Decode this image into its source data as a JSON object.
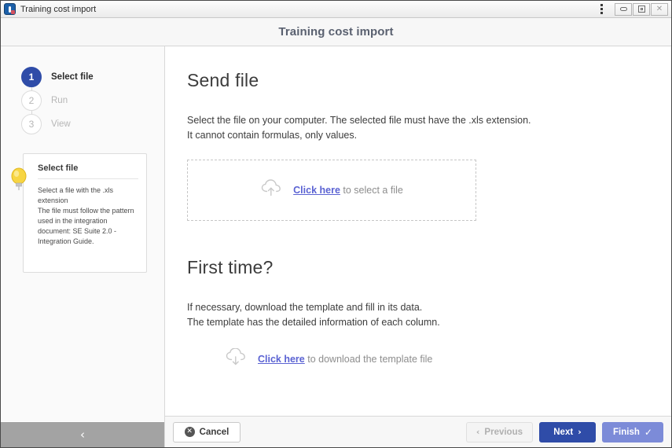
{
  "titlebar": {
    "title": "Training cost import",
    "app_icon": "app-icon",
    "menu_icon": "kebab-menu-icon",
    "minimize_label": "",
    "maximize_label": "",
    "close_label": "✕"
  },
  "header": {
    "title": "Training cost import"
  },
  "sidebar": {
    "steps": [
      {
        "number": "1",
        "label": "Select file",
        "state": "active"
      },
      {
        "number": "2",
        "label": "Run",
        "state": "inactive"
      },
      {
        "number": "3",
        "label": "View",
        "state": "inactive"
      }
    ],
    "hint": {
      "icon": "lightbulb-icon",
      "title": "Select file",
      "lines": [
        "Select a file with the .xls",
        "extension",
        "The file must follow the pattern",
        "used in the integration",
        "document: SE Suite 2.0 -",
        "Integration Guide."
      ]
    },
    "collapse": {
      "icon": "chevron-left-icon",
      "glyph": "‹"
    }
  },
  "main": {
    "send_file": {
      "heading": "Send file",
      "description_line1": "Select the file on your computer. The selected file must have the .xls extension.",
      "description_line2": "It cannot contain formulas, only values.",
      "dropzone": {
        "icon": "cloud-upload-icon",
        "link_text": "Click here",
        "rest_text": " to select a file"
      }
    },
    "first_time": {
      "heading": "First time?",
      "description_line1": "If necessary, download the template and fill in its data.",
      "description_line2": "The template has the detailed information of each column.",
      "download": {
        "icon": "cloud-download-icon",
        "link_text": "Click here",
        "rest_text": " to download the template file"
      }
    }
  },
  "footer": {
    "cancel_label": "Cancel",
    "cancel_icon": "cancel-circle-icon",
    "previous_label": "Previous",
    "previous_icon": "chevron-left-icon",
    "previous_glyph": "‹",
    "next_label": "Next",
    "next_icon": "chevron-right-icon",
    "next_glyph": "›",
    "finish_label": "Finish",
    "finish_icon": "check-icon",
    "finish_glyph": "✓"
  },
  "colors": {
    "accent_blue": "#2f4ca8",
    "finish_blue": "#7c8bd8",
    "link_blue": "#5b63d3",
    "sidebar_bg": "#fafafa",
    "collapse_bar": "#a3a3a3",
    "bulb_yellow": "#f5d03c"
  }
}
